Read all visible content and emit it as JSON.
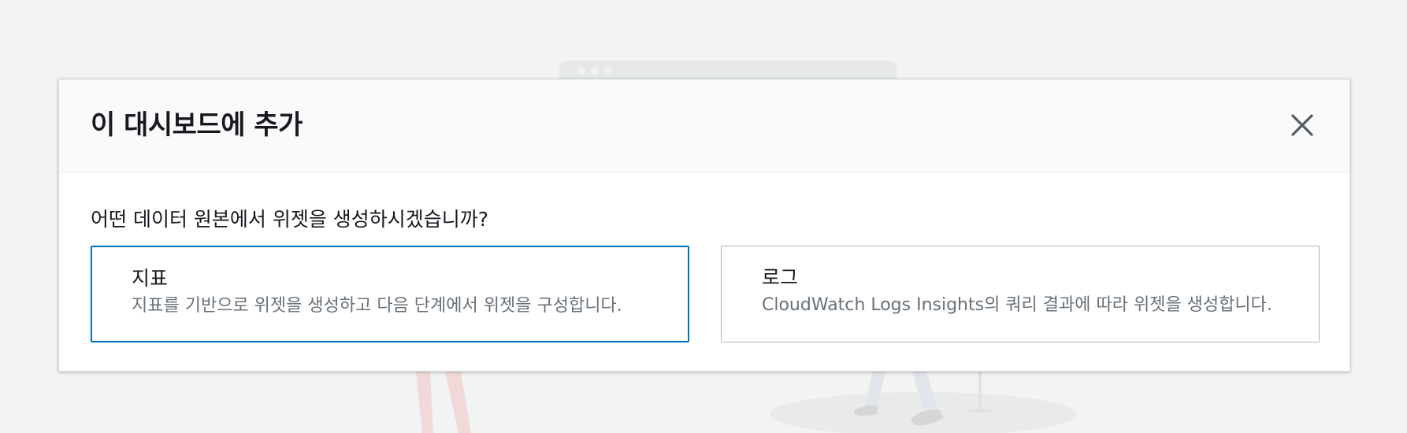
{
  "modal": {
    "title": "이 대시보드에 추가",
    "close_icon": "close-icon"
  },
  "body": {
    "question": "어떤 데이터 원본에서 위젯을 생성하시겠습니까?",
    "tiles": [
      {
        "title": "지표",
        "description": "지표를 기반으로 위젯을 생성하고 다음 단계에서 위젯을 구성합니다.",
        "selected": true
      },
      {
        "title": "로그",
        "description": "CloudWatch Logs Insights의 쿼리 결과에 따라 위젯을 생성합니다.",
        "selected": false
      }
    ]
  },
  "colors": {
    "page_background": "#f2f3f3",
    "selected_border": "#0073bb",
    "default_border": "#aab7b8",
    "title_text": "#16191f",
    "description_text": "#687078"
  }
}
